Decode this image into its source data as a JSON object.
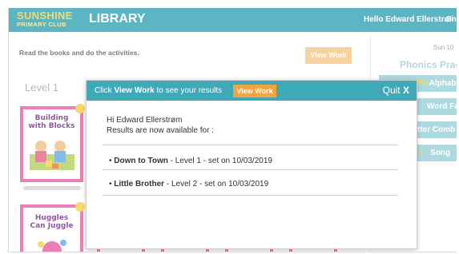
{
  "header": {
    "logo_line1": "SUNSHINE",
    "logo_line2": "PRIMARY CLUB",
    "title": "LIBRARY",
    "greeting": "Hello Edward Ellerstrøm",
    "signout": "Si"
  },
  "page": {
    "instructions": "Read the books and do the activities.",
    "view_work_label": "View Work",
    "date": "Sun 10",
    "phonics_title": "Phonics Prac",
    "phonics_items": [
      "Alphab",
      "Word Fa",
      "tter Comb",
      "Song"
    ],
    "level_label": "Level 1",
    "books": [
      {
        "title_line1": "Building",
        "title_line2": "with Blocks"
      },
      {
        "title_line1": "Huggles",
        "title_line2": "Can Juggle"
      }
    ]
  },
  "modal": {
    "message_prefix": "Click ",
    "message_bold": "View Work",
    "message_suffix": " to see your results",
    "view_work_label": "View Work",
    "quit_label": "Quit",
    "quit_x": "X",
    "greeting": "Hi Edward Ellerstrøm",
    "available_text": "Results are now available for :",
    "results": [
      {
        "title": "Down to Town",
        "detail": " - Level 1 - set on 10/03/2019"
      },
      {
        "title": "Little Brother",
        "detail": " - Level 2 - set on 10/03/2019"
      }
    ]
  },
  "colors": {
    "accent": "#3fa9b8",
    "button_orange": "#f4a43a",
    "book_border": "#e96aa8"
  }
}
